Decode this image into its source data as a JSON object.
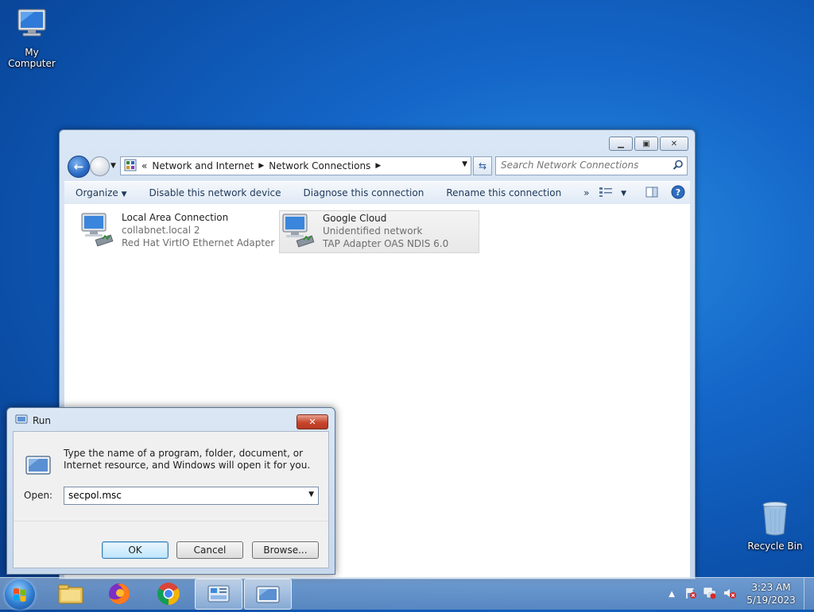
{
  "desktop": {
    "icons": [
      {
        "label": "My Computer"
      },
      {
        "label": "Recycle Bin"
      }
    ]
  },
  "explorer": {
    "breadcrumb": {
      "chevrons": "«",
      "parts": [
        "Network and Internet",
        "Network Connections"
      ]
    },
    "search_placeholder": "Search Network Connections",
    "commands": {
      "organize": "Organize",
      "disable": "Disable this network device",
      "diagnose": "Diagnose this connection",
      "rename": "Rename this connection",
      "more": "»"
    },
    "connections": [
      {
        "name": "Local Area Connection",
        "network": "collabnet.local  2",
        "adapter": "Red Hat VirtIO Ethernet Adapter",
        "selected": false
      },
      {
        "name": "Google Cloud",
        "network": "Unidentified network",
        "adapter": "TAP Adapter OAS NDIS 6.0",
        "selected": true
      }
    ]
  },
  "run_dialog": {
    "title": "Run",
    "message": "Type the name of a program, folder, document, or Internet resource, and Windows will open it for you.",
    "open_label": "Open:",
    "open_value": "secpol.msc",
    "ok": "OK",
    "cancel": "Cancel",
    "browse": "Browse..."
  },
  "taskbar": {
    "time": "3:23 AM",
    "date": "5/19/2023"
  },
  "colors": {
    "desktop_blue": "#1466c8",
    "close_red": "#c8452b",
    "link_blue": "#1e395b"
  }
}
